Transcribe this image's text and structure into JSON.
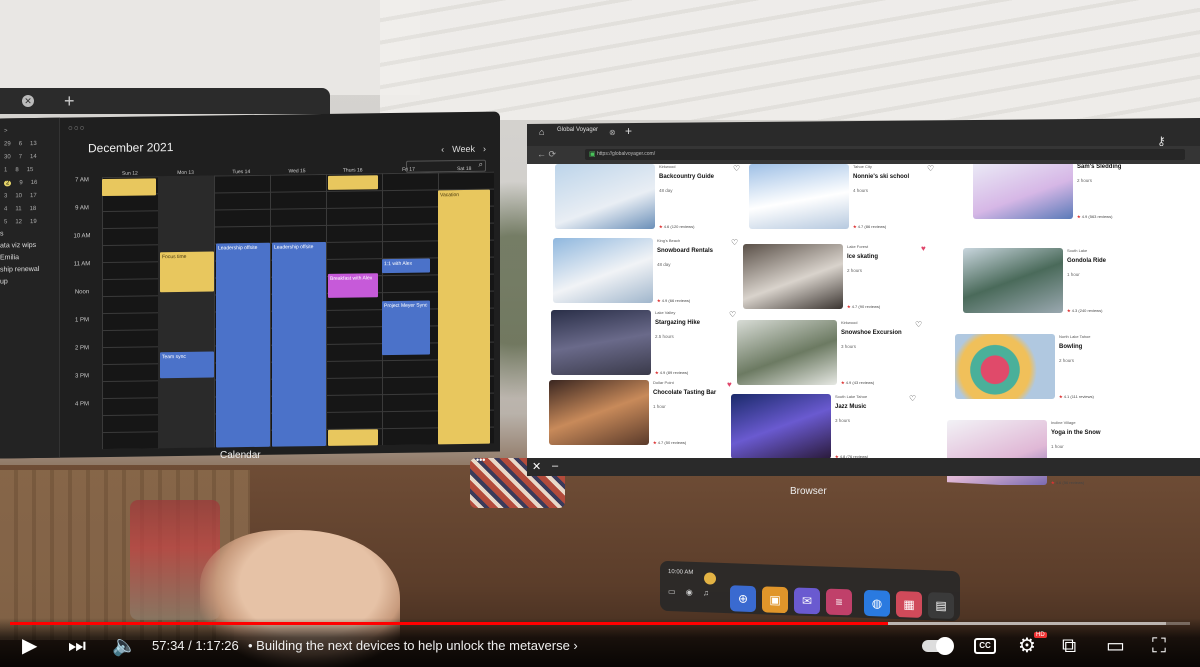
{
  "calendar": {
    "month_title": "December 2021",
    "view": "Week",
    "window_label": "Calendar",
    "mini": [
      [
        ">"
      ],
      [
        "29",
        "6",
        "13"
      ],
      [
        "30",
        "7",
        "14"
      ],
      [
        "1",
        "8",
        "15"
      ],
      [
        "2",
        "9",
        "16"
      ],
      [
        "3",
        "10",
        "17"
      ],
      [
        "4",
        "11",
        "18"
      ],
      [
        "5",
        "12",
        "19"
      ]
    ],
    "side_items": [
      "s",
      "ata viz wips",
      "Emilia",
      "ship renewal",
      "up",
      ""
    ],
    "days": [
      "Sun 12",
      "Mon 13",
      "Tues 14",
      "Wed 15",
      "Thurs 16",
      "Fri 17",
      "Sat 18"
    ],
    "hours": [
      "7 AM",
      "9 AM",
      "10 AM",
      "11 AM",
      "Noon",
      "1 PM",
      "2 PM",
      "3 PM",
      "4 PM",
      ""
    ],
    "events": [
      "Focus time",
      "Leadership offsite",
      "Leadership offsite",
      "Breakfast with Alex",
      "1:1 with Alex",
      "Project Meyer Sync",
      "Team sync",
      "Vacation"
    ]
  },
  "browser": {
    "tab_title": "Global Voyager",
    "url": "https://globalvoyager.com/",
    "window_label": "Browser",
    "cards": [
      {
        "location": "Kirkwood",
        "title": "Backcountry Guide",
        "duration": "48 day",
        "rating": "4.6 (120 reviews)"
      },
      {
        "location": "Tahoe City",
        "title": "Nonnie's ski school",
        "duration": "4 hours",
        "rating": "4.7 (86 reviews)"
      },
      {
        "location": "Incline Village",
        "title": "Sam's Sledding",
        "duration": "2 hours",
        "rating": "4.9 (563 reviews)"
      },
      {
        "location": "King's Beach",
        "title": "Snowboard Rentals",
        "duration": "48 day",
        "rating": "4.9 (66 reviews)"
      },
      {
        "location": "Lake Forest",
        "title": "Ice skating",
        "duration": "2 hours",
        "rating": "4.7 (90 reviews)"
      },
      {
        "location": "South Lake",
        "title": "Gondola Ride",
        "duration": "1 hour",
        "rating": "4.3 (240 reviews)"
      },
      {
        "location": "Lake Valley",
        "title": "Stargazing Hike",
        "duration": "2.5 hours",
        "rating": "4.9 (89 reviews)"
      },
      {
        "location": "Kirkwood",
        "title": "Snowshoe Excursion",
        "duration": "3 hours",
        "rating": "4.9 (43 reviews)"
      },
      {
        "location": "North Lake Tahoe",
        "title": "Bowling",
        "duration": "2 hours",
        "rating": "4.1 (111 reviews)"
      },
      {
        "location": "Dollar Point",
        "title": "Chocolate Tasting Bar",
        "duration": "1 hour",
        "rating": "4.7 (50 reviews)"
      },
      {
        "location": "South Lake Tahoe",
        "title": "Jazz Music",
        "duration": "3 hours",
        "rating": "4.8 (76 reviews)"
      },
      {
        "location": "Incline Village",
        "title": "Yoga in the Snow",
        "duration": "1 hour",
        "rating": "4.6 (56 reviews)"
      }
    ]
  },
  "dock": {
    "time": "10:00 AM"
  },
  "player": {
    "current_time": "57:34",
    "duration": "1:17:26",
    "chapter": "Building the next devices to help unlock the metaverse",
    "cc_label": "CC",
    "quality_badge": "HD",
    "played_fraction": 0.744,
    "buffered_fraction": 0.98,
    "accent_color": "#ff0000"
  }
}
